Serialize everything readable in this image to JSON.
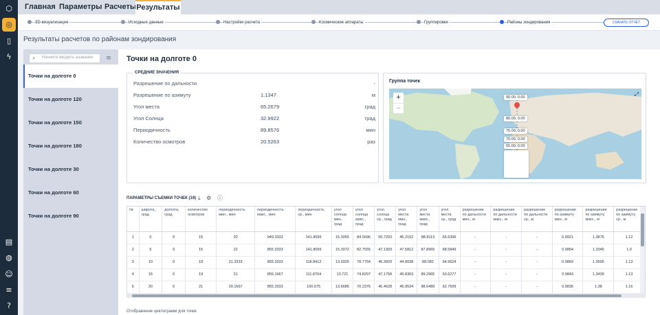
{
  "rail": {
    "icons": [
      "logo-icon",
      "compass-icon",
      "bookmark-icon",
      "lightning-icon",
      "report-icon",
      "database-icon",
      "user-icon",
      "sliders-icon",
      "help-icon"
    ]
  },
  "topnav": {
    "tabs": [
      "Главная",
      "Параметры",
      "Расчеты",
      "Результаты"
    ],
    "active": "Результаты"
  },
  "steps": [
    "3D-визуализация",
    "Исходные данные",
    "Настройки расчета",
    "Космические аппараты",
    "Группировки",
    "Районы зондирования"
  ],
  "report_button": "СКАЧАТЬ ОТЧЕТ",
  "page_title": "Результаты расчетов по районам зондирования",
  "search": {
    "placeholder": "Начните вводить название"
  },
  "list": [
    "Точки на долготе 0",
    "Точки на долготе 120",
    "Точки на долготе 150",
    "Точки на долготе 180",
    "Точки на долготе 30",
    "Точки на долготе 60",
    "Точки на долготе 90"
  ],
  "content_title": "Точки на долготе 0",
  "averages": {
    "caption": "СРЕДНИЕ ЗНАЧЕНИЯ",
    "rows": [
      {
        "label": "Разрешение по дальности",
        "value": "",
        "unit": "-"
      },
      {
        "label": "Разрешение по азимуту",
        "value": "1.1347",
        "unit": "м"
      },
      {
        "label": "Угол места",
        "value": "65.2679",
        "unit": "град"
      },
      {
        "label": "Угол Солнца",
        "value": "32.9922",
        "unit": "град"
      },
      {
        "label": "Периодичность",
        "value": "89.8576",
        "unit": "мин"
      },
      {
        "label": "Количество осмотров",
        "value": "20.5263",
        "unit": "раз"
      }
    ]
  },
  "map": {
    "caption": "Группа точек",
    "zoom_in": "+",
    "zoom_out": "−",
    "labels": [
      "90.00, 0.00",
      "80.00, 0.00",
      "75.00, 0.00",
      "70.00, 0.00",
      "65.00, 0.00"
    ]
  },
  "table": {
    "caption": "ПАРАМЕТРЫ СЪЕМКИ ТОЧЕК (19)",
    "headers": [
      "№",
      "широта, град",
      "долгота, град",
      "количество осмотров",
      "периодичность мин., мин",
      "периодичность макс., мин",
      "периодичность ср., мин",
      "угол солнца мин., град",
      "угол солнца макс., град",
      "угол солнца ср., град",
      "угол места мин., град",
      "угол места макс., град",
      "угол места ср., град",
      "разрешение по дальности мин., м",
      "разрешение по дальности макс., м",
      "разрешение по дальности ср., м",
      "разрешение по азимуту мин., м",
      "разрешение по азимуту макс., м",
      "разрешение по азимуту ср., м"
    ],
    "rows": [
      [
        "1",
        "0",
        "0",
        "15",
        "20",
        "949.3333",
        "141.8095",
        "15.3055",
        "84.5696",
        "50.7203",
        "45.2152",
        "88.8113",
        "65.6396",
        "-",
        "-",
        "-",
        "0.9921",
        "1.3876",
        "1.12"
      ],
      [
        "2",
        "5",
        "0",
        "15",
        "22",
        "855.3333",
        "141.8095",
        "15.3072",
        "82.7555",
        "47.1303",
        "47.5812",
        "87.8965",
        "68.5849",
        "-",
        "-",
        "-",
        "0.9854",
        "1.3345",
        "1.0"
      ],
      [
        "3",
        "10",
        "0",
        "18",
        "21.3333",
        "855.3333",
        "118.8412",
        "13.6925",
        "78.7754",
        "46.3603",
        "44.8038",
        "88.082",
        "64.9624",
        "-",
        "-",
        "-",
        "0.9869",
        "1.3995",
        "1.13"
      ],
      [
        "4",
        "15",
        "0",
        "19",
        "21",
        "855.1667",
        "111.8704",
        "13.721",
        "74.8297",
        "47.1758",
        "45.8363",
        "89.2965",
        "63.6277",
        "-",
        "-",
        "-",
        "0.9843",
        "1.3439",
        "1.13"
      ],
      [
        "5",
        "20",
        "0",
        "21",
        "20.1667",
        "855.3333",
        "100.675",
        "13.6685",
        "70.2376",
        "45.4628",
        "45.9534",
        "88.6489",
        "62.7609",
        "-",
        "-",
        "-",
        "0.9836",
        "1.38",
        "1.16"
      ]
    ]
  },
  "cyclogram_label": "Отображение циклограмм для точек",
  "colors": {
    "accent": "#2b5ee8",
    "highlight": "#f2b134",
    "rail": "#1d2c3c"
  }
}
